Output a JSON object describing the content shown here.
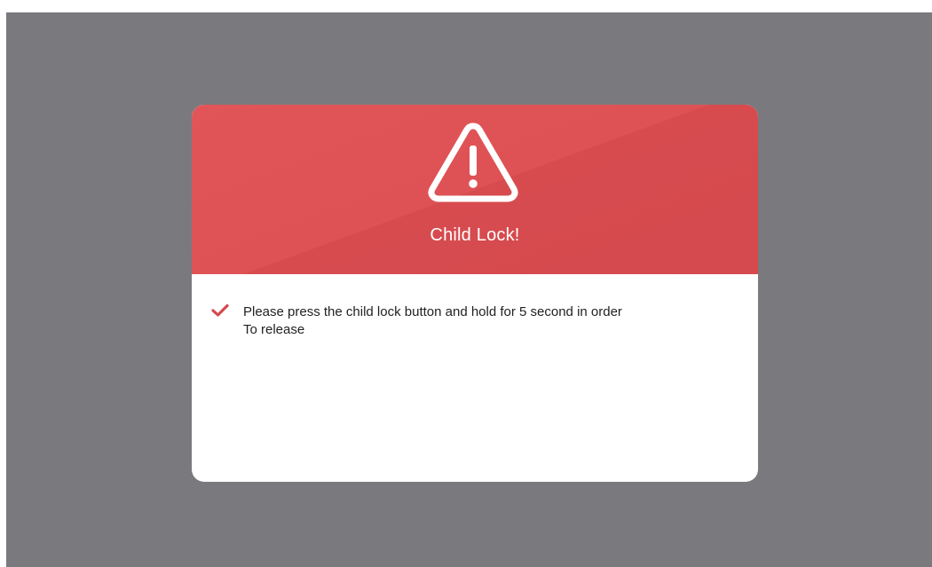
{
  "dialog": {
    "title": "Child Lock!",
    "icon": "warning-triangle-icon",
    "message_lines": [
      "Please press the child lock button and hold for 5 second in order",
      "To release"
    ],
    "bullet_icon": "check-icon"
  },
  "colors": {
    "backdrop": "#7a7a7e",
    "header": "#de5256",
    "accent": "#d44a4e",
    "body": "#ffffff"
  }
}
